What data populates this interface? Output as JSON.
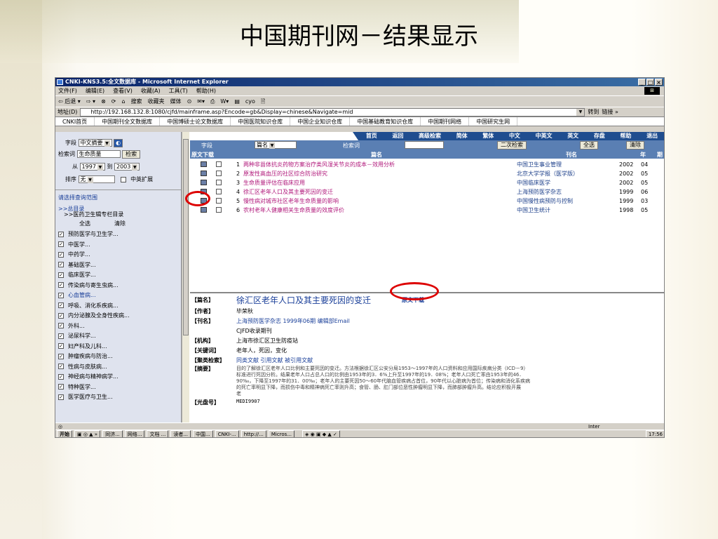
{
  "slide_title": "中国期刊网－结果显示",
  "window": {
    "title": "CNKI-KNS3.5:全文数据库 - Microsoft Internet Explorer",
    "menu": [
      "文件(F)",
      "编辑(E)",
      "查看(V)",
      "收藏(A)",
      "工具(T)",
      "帮助(H)"
    ],
    "toolbar": [
      "⇦ 后退 ▾",
      "⇨ ▾",
      "⊗",
      "⟳",
      "⌂",
      "搜索",
      "收藏夹",
      "媒体",
      "⊙",
      "✉▾",
      "⎙",
      "W▾",
      "▤",
      "cyo",
      "🗎"
    ],
    "address_label": "地址(D)",
    "address": "http://192.168.132.8:1080/cjfd/mainframe.asp?Encode=gb&Display=chinese&Navigate=mid",
    "go_label": "转到",
    "links_label": "链接 »"
  },
  "nav_tabs": [
    "CNKI首页",
    "中国期刊全文数据库",
    "中国博硕士论文数据库",
    "中国医院知识仓库",
    "中国企业知识仓库",
    "中国基础教育知识仓库",
    "中国期刊网络",
    "中国研究生网"
  ],
  "left_panel": {
    "field_label": "字段",
    "field_value": "中文摘要",
    "keyword_label": "检索词",
    "keyword_value": "生命质量",
    "search_button": "检索",
    "from_label": "从",
    "from_year": "1997",
    "to_label": "到",
    "to_year": "2003",
    "sort_label": "排序",
    "sort_value": "无",
    "expand_label": "中英扩展",
    "scope_link": "请选择查询范围",
    "root": ">>总目录",
    "sub": ">>医药卫生辑专栏目录",
    "select_all": "全选",
    "clear": "清除",
    "categories": [
      "预防医学与卫生学...",
      "中医学...",
      "中药学...",
      "基础医学...",
      "临床医学...",
      "传染病与寄生虫病...",
      "心血管病...",
      "呼吸、消化系疾病...",
      "内分泌腺及全身性疾病...",
      "外科...",
      "泌尿科学...",
      "妇产科及儿科...",
      "肿瘤疾病与防治...",
      "性病与皮肤病...",
      "神经病与精神病学...",
      "特种医学...",
      "医学医疗与卫生..."
    ]
  },
  "top_menu": [
    "首页",
    "返回",
    "高级检索",
    "简体",
    "繁体",
    "中文",
    "中英文",
    "英文",
    "存盘",
    "帮助",
    "退出"
  ],
  "filter": {
    "field_label": "字段",
    "field_value": "篇名",
    "term_label": "检索词",
    "secondary": "二次检索",
    "select_all": "全选",
    "clear": "清除"
  },
  "columns": {
    "download": "原文下载",
    "title": "篇名",
    "journal": "刊名",
    "year": "年",
    "issue": "期"
  },
  "results": [
    {
      "n": "1",
      "title": "两种非甾体抗炎药物方案治疗类风湿关节炎的成本－效用分析",
      "journal": "中国卫生事业管理",
      "year": "2002",
      "issue": "04"
    },
    {
      "n": "2",
      "title": "原发性高血压的社区综合防治研究",
      "journal": "北京大学学报（医学版）",
      "year": "2002",
      "issue": "05"
    },
    {
      "n": "3",
      "title": "生命质量评估在临床应用",
      "journal": "中国临床医学",
      "year": "2002",
      "issue": "05"
    },
    {
      "n": "4",
      "title": "徐汇区老年人口及其主要死因的变迁",
      "journal": "上海预防医学杂志",
      "year": "1999",
      "issue": "06"
    },
    {
      "n": "5",
      "title": "慢性病对城市社区老年生命质量的影响",
      "journal": "中国慢性病预防与控制",
      "year": "1999",
      "issue": "03"
    },
    {
      "n": "6",
      "title": "农村老年人健康相关生命质量的效度评价",
      "journal": "中国卫生统计",
      "year": "1998",
      "issue": "05"
    }
  ],
  "detail": {
    "title_key": "【篇名】",
    "title": "徐汇区老年人口及其主要死因的变迁",
    "download": "原文下载",
    "author_key": "【作者】",
    "author": "毕荣秋",
    "journal_key": "【刊名】",
    "journal": "上海预防医学杂志  1999年06期  编辑部Email",
    "cjfd": "CJFD收录期刊",
    "org_key": "【机构】",
    "org": "上海市徐汇区卫生防疫站",
    "kw_key": "【关键词】",
    "kw": "老年人，死因，变化",
    "sim_key": "【聚类检索】",
    "sim": "同类文献  引用文献  被引用文献",
    "abs_key": "【摘要】",
    "abs1": "目的了解徐汇区老年人口比例和主要死因的变迁。方法根据徐汇区公安分局1953～1997年的人口资料和应用国际疾病分类（ICD－9）",
    "abs2": "标准进行死因分析。结果老年人口占总人口的比例由1953年的3．6%上升至1997年的19．08%；老年人口死亡率由1953年的46．",
    "abs3": "90‰，下降至1997年的31．00‰；老年人的主要死因50～60年代脑血管疾病占首位，90年代以心脏病为首位；传染病和消化系疾病",
    "abs4": "的死亡率明显下降，而损伤中毒和精神病死亡率则升高；食管、肠、肛门部位恶性肿瘤明显下降，而肺部肿瘤升高。结论应积极开展",
    "abs5": "老",
    "cd_key": "【光盘号】",
    "cd": "MEDI9907"
  },
  "status_right": "Inter",
  "taskbar": [
    "开始",
    "同济...",
    "网络...",
    "文档 ...",
    "读者...",
    "中国...",
    "CNKI-...",
    "http://...",
    "Micros..."
  ],
  "clock": "17:56"
}
